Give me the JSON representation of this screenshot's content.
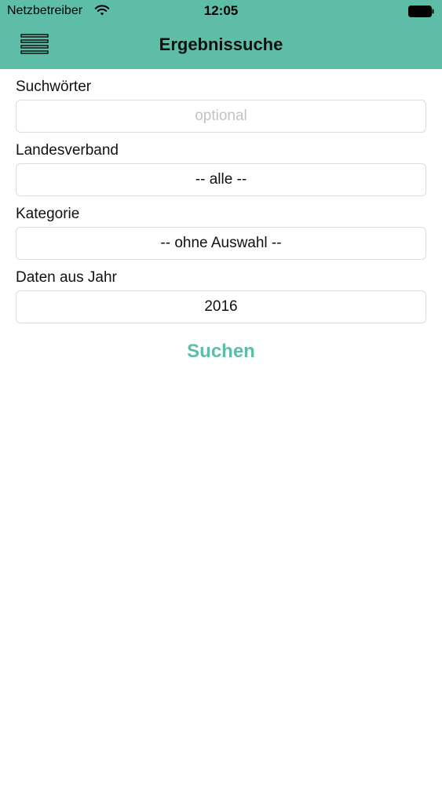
{
  "status_bar": {
    "carrier": "Netzbetreiber",
    "time": "12:05",
    "wifi_icon": "wifi-icon",
    "battery_icon": "battery-icon"
  },
  "nav": {
    "title": "Ergebnissuche",
    "menu_icon": "hamburger-menu-icon",
    "background_color": "#5ebda7"
  },
  "form": {
    "keywords": {
      "label": "Suchwörter",
      "placeholder": "optional",
      "value": ""
    },
    "association": {
      "label": "Landesverband",
      "value": "-- alle --"
    },
    "category": {
      "label": "Kategorie",
      "value": "-- ohne Auswahl --"
    },
    "year": {
      "label": "Daten aus Jahr",
      "value": "2016"
    },
    "search_label": "Suchen",
    "accent_color": "#5ebda7"
  }
}
